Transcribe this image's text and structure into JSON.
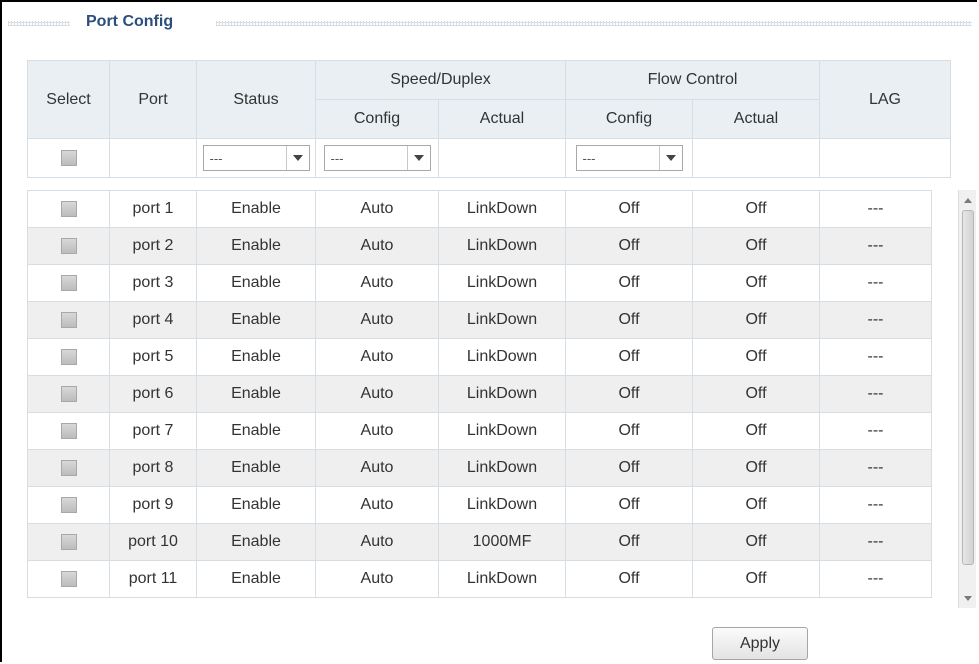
{
  "section": {
    "title": "Port Config"
  },
  "table": {
    "headers": {
      "select": "Select",
      "port": "Port",
      "status": "Status",
      "speed_duplex": "Speed/Duplex",
      "flow_control": "Flow Control",
      "lag": "LAG",
      "config": "Config",
      "actual": "Actual"
    },
    "filters": {
      "status": "---",
      "speed_config": "---",
      "flow_config": "---"
    },
    "rows": [
      {
        "port": "port 1",
        "status": "Enable",
        "speed_config": "Auto",
        "speed_actual": "LinkDown",
        "flow_config": "Off",
        "flow_actual": "Off",
        "lag": "---"
      },
      {
        "port": "port 2",
        "status": "Enable",
        "speed_config": "Auto",
        "speed_actual": "LinkDown",
        "flow_config": "Off",
        "flow_actual": "Off",
        "lag": "---"
      },
      {
        "port": "port 3",
        "status": "Enable",
        "speed_config": "Auto",
        "speed_actual": "LinkDown",
        "flow_config": "Off",
        "flow_actual": "Off",
        "lag": "---"
      },
      {
        "port": "port 4",
        "status": "Enable",
        "speed_config": "Auto",
        "speed_actual": "LinkDown",
        "flow_config": "Off",
        "flow_actual": "Off",
        "lag": "---"
      },
      {
        "port": "port 5",
        "status": "Enable",
        "speed_config": "Auto",
        "speed_actual": "LinkDown",
        "flow_config": "Off",
        "flow_actual": "Off",
        "lag": "---"
      },
      {
        "port": "port 6",
        "status": "Enable",
        "speed_config": "Auto",
        "speed_actual": "LinkDown",
        "flow_config": "Off",
        "flow_actual": "Off",
        "lag": "---"
      },
      {
        "port": "port 7",
        "status": "Enable",
        "speed_config": "Auto",
        "speed_actual": "LinkDown",
        "flow_config": "Off",
        "flow_actual": "Off",
        "lag": "---"
      },
      {
        "port": "port 8",
        "status": "Enable",
        "speed_config": "Auto",
        "speed_actual": "LinkDown",
        "flow_config": "Off",
        "flow_actual": "Off",
        "lag": "---"
      },
      {
        "port": "port 9",
        "status": "Enable",
        "speed_config": "Auto",
        "speed_actual": "LinkDown",
        "flow_config": "Off",
        "flow_actual": "Off",
        "lag": "---"
      },
      {
        "port": "port 10",
        "status": "Enable",
        "speed_config": "Auto",
        "speed_actual": "1000MF",
        "flow_config": "Off",
        "flow_actual": "Off",
        "lag": "---"
      },
      {
        "port": "port 11",
        "status": "Enable",
        "speed_config": "Auto",
        "speed_actual": "LinkDown",
        "flow_config": "Off",
        "flow_actual": "Off",
        "lag": "---"
      }
    ]
  },
  "apply_label": "Apply"
}
